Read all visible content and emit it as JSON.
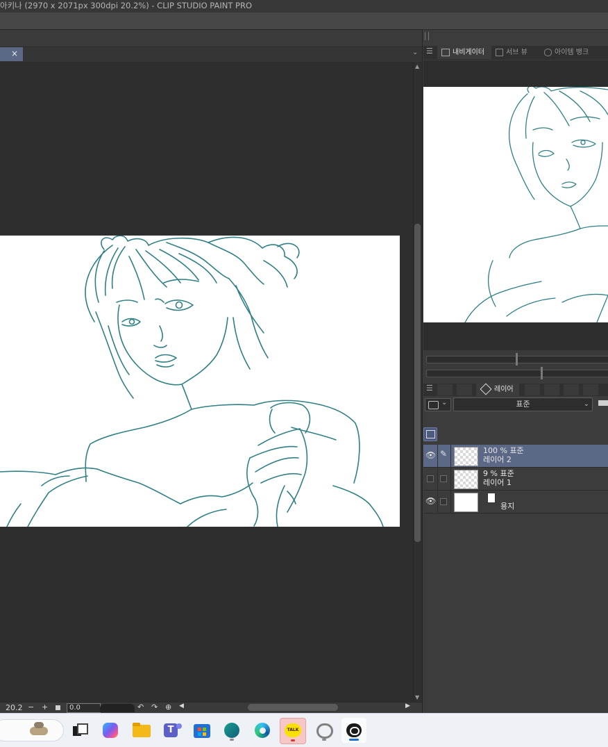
{
  "window": {
    "title": "아키나 (2970 x 2071px 300dpi 20.2%)  - CLIP STUDIO PAINT PRO"
  },
  "document_tab": {
    "close_glyph": "×"
  },
  "statusbar": {
    "zoom": "20.2",
    "zoom_out": "−",
    "zoom_in": "+",
    "rotation": "0.0"
  },
  "panel_tabs": [
    {
      "label": "내비게이터",
      "icon": "navigator-icon"
    },
    {
      "label": "서브 뷰",
      "icon": "subview-icon"
    },
    {
      "label": "아이템 뱅크",
      "icon": "item-bank-icon"
    }
  ],
  "layer_tabs": {
    "active_label": "레이어",
    "active_icon": "layers-icon"
  },
  "layer_palette": {
    "blend_mode": "표준"
  },
  "layers": [
    {
      "opacity_mode": "100 % 표준",
      "name": "레이어 2",
      "selected": true,
      "visible": true,
      "thumbnail": "transparent"
    },
    {
      "opacity_mode": "9 % 표준",
      "name": "레이어 1",
      "selected": false,
      "visible": false,
      "thumbnail": "transparent"
    },
    {
      "opacity_mode": "",
      "name": "용지",
      "selected": false,
      "visible": true,
      "thumbnail": "white"
    }
  ],
  "taskbar": {
    "apps": [
      {
        "name": "widgets",
        "icon": "stones-icon"
      },
      {
        "name": "task-view",
        "icon": "task-view-icon"
      },
      {
        "name": "copilot",
        "icon": "copilot-icon"
      },
      {
        "name": "file-explorer",
        "icon": "folder-icon"
      },
      {
        "name": "teams",
        "icon": "teams-icon"
      },
      {
        "name": "microsoft-store",
        "icon": "store-icon"
      },
      {
        "name": "app-teal",
        "icon": "teal-app-icon"
      },
      {
        "name": "edge",
        "icon": "edge-icon"
      },
      {
        "name": "kakaotalk",
        "icon": "kakaotalk-icon",
        "label": "TALK"
      },
      {
        "name": "clip-studio",
        "icon": "clip-studio-icon"
      },
      {
        "name": "clip-studio-paint",
        "icon": "clip-studio-paint-icon"
      }
    ]
  },
  "colors": {
    "accent": "#5b6886",
    "line_art": "#2f7f84"
  }
}
